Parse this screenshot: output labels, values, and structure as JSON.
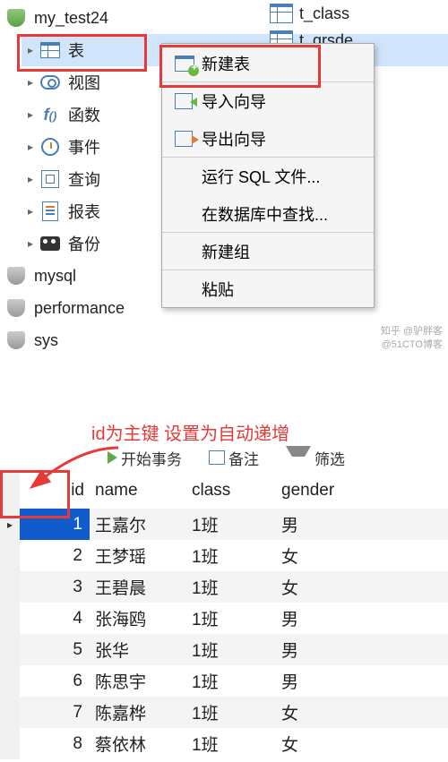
{
  "database_name": "my_test24",
  "top_tables": [
    "t_class",
    "t_grsde"
  ],
  "tree_items": [
    {
      "label": "表",
      "icon": "table",
      "selected": true
    },
    {
      "label": "视图",
      "icon": "view"
    },
    {
      "label": "函数",
      "icon": "fn"
    },
    {
      "label": "事件",
      "icon": "event"
    },
    {
      "label": "查询",
      "icon": "query"
    },
    {
      "label": "报表",
      "icon": "report"
    },
    {
      "label": "备份",
      "icon": "backup"
    }
  ],
  "gray_dbs": [
    "mysql",
    "performance",
    "sys"
  ],
  "context_menu": {
    "new_table": "新建表",
    "import_wizard": "导入向导",
    "export_wizard": "导出向导",
    "run_sql": "运行 SQL 文件...",
    "find_in_db": "在数据库中查找...",
    "new_group": "新建组",
    "paste": "粘贴"
  },
  "annotation_text": "id为主键 设置为自动递增",
  "toolbar": {
    "start_tx": "开始事务",
    "memo": "备注",
    "filter": "筛选"
  },
  "columns": [
    "id",
    "name",
    "class",
    "gender"
  ],
  "rows": [
    {
      "id": 1,
      "name": "王嘉尔",
      "class": "1班",
      "gender": "男",
      "current": true
    },
    {
      "id": 2,
      "name": "王梦瑶",
      "class": "1班",
      "gender": "女"
    },
    {
      "id": 3,
      "name": "王碧晨",
      "class": "1班",
      "gender": "女"
    },
    {
      "id": 4,
      "name": "张海鸥",
      "class": "1班",
      "gender": "男"
    },
    {
      "id": 5,
      "name": "张华",
      "class": "1班",
      "gender": "男"
    },
    {
      "id": 6,
      "name": "陈思宇",
      "class": "1班",
      "gender": "男"
    },
    {
      "id": 7,
      "name": "陈嘉桦",
      "class": "1班",
      "gender": "女"
    },
    {
      "id": 8,
      "name": "蔡依林",
      "class": "1班",
      "gender": "女"
    }
  ],
  "watermark": {
    "line1": "知乎 @驴胖客",
    "line2": "@51CTO博客"
  }
}
